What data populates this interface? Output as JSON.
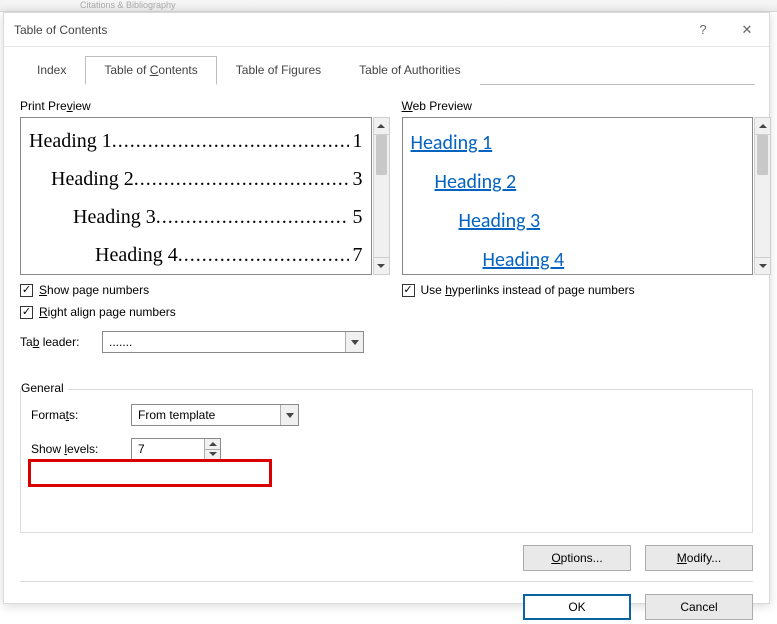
{
  "ribbon_hint": "Citations & Bibliography",
  "dialog": {
    "title": "Table of Contents",
    "help_symbol": "?",
    "close_symbol": "✕"
  },
  "tabs": {
    "index": "Index",
    "toc": "Table of Contents",
    "figures": "Table of Figures",
    "authorities": "Table of Authorities"
  },
  "print_preview": {
    "label_pre": "Print Pre",
    "label_u": "v",
    "label_post": "iew",
    "rows": [
      {
        "label": "Heading 1",
        "page": "1",
        "indent": ""
      },
      {
        "label": "Heading 2",
        "page": "3",
        "indent": "indent-1"
      },
      {
        "label": "Heading 3",
        "page": "5",
        "indent": "indent-2"
      },
      {
        "label": "Heading 4",
        "page": "7",
        "indent": "indent-3"
      }
    ]
  },
  "web_preview": {
    "label_u": "W",
    "label_post": "eb Preview",
    "links": [
      {
        "text": "Heading 1",
        "cls": "wl1"
      },
      {
        "text": "Heading 2",
        "cls": "wl2"
      },
      {
        "text": "Heading 3",
        "cls": "wl3"
      },
      {
        "text": "Heading 4",
        "cls": "wl4"
      }
    ]
  },
  "checkboxes": {
    "show_page_numbers": {
      "pre": "",
      "u": "S",
      "post": "how page numbers",
      "checked": true
    },
    "right_align": {
      "pre": "",
      "u": "R",
      "post": "ight align page numbers",
      "checked": true
    },
    "use_hyperlinks": {
      "pre": "Use ",
      "u": "h",
      "post": "yperlinks instead of page numbers",
      "checked": true
    }
  },
  "tab_leader": {
    "label_pre": "Ta",
    "label_u": "b",
    "label_post": " leader:",
    "value": "......."
  },
  "general": {
    "title": "General",
    "formats": {
      "label_pre": "Forma",
      "label_u": "t",
      "label_post": "s:",
      "value": "From template"
    },
    "show_levels": {
      "label_pre": "Show ",
      "label_u": "l",
      "label_post": "evels:",
      "value": "7"
    }
  },
  "buttons": {
    "options": {
      "u": "O",
      "post": "ptions..."
    },
    "modify": {
      "u": "M",
      "post": "odify..."
    },
    "ok": "OK",
    "cancel": "Cancel"
  }
}
